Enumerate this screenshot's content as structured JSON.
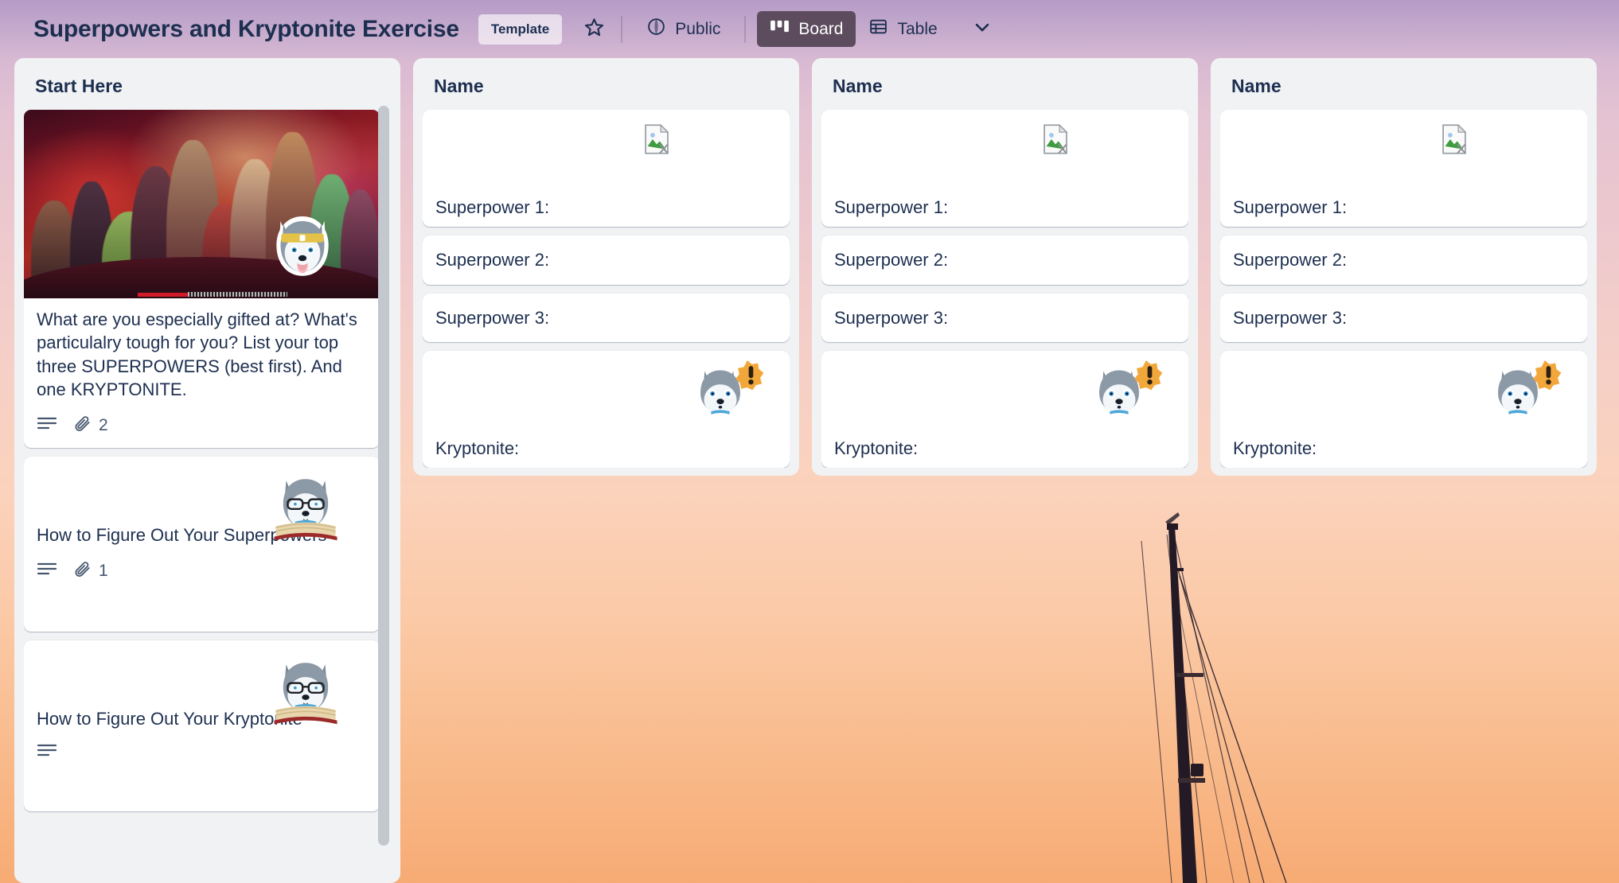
{
  "header": {
    "board_title": "Superpowers and Kryptonite Exercise",
    "template_badge": "Template",
    "star_icon": "star-outline-icon",
    "visibility_icon": "globe-icon",
    "visibility_label": "Public",
    "board_view_icon": "board-view-icon",
    "board_view_label": "Board",
    "table_view_icon": "table-view-icon",
    "table_view_label": "Table",
    "more_views_icon": "chevron-down-icon",
    "accent_active_bg": "#5d4b5e",
    "text_color": "#1d2f50"
  },
  "lists": [
    {
      "title": "Start Here",
      "cards": [
        {
          "id": "intro",
          "type": "cover",
          "cover_icon": "avengers-poster-image",
          "sticker": "husky-headband-tongue-sticker",
          "title": "What are you especially gifted at? What's particulalry tough for you? List your top three SUPERPOWERS (best first). And one KRYPTONITE.",
          "badges": {
            "description_icon": "description-lines-icon",
            "attachment_icon": "paperclip-icon",
            "attachment_count": "2"
          }
        },
        {
          "id": "how-superpowers",
          "type": "sticker",
          "sticker": "husky-glasses-book-sticker",
          "title": "How to Figure Out Your Superpowers",
          "badges": {
            "description_icon": "description-lines-icon",
            "attachment_icon": "paperclip-icon",
            "attachment_count": "1"
          }
        },
        {
          "id": "how-kryptonite",
          "type": "sticker",
          "sticker": "husky-glasses-book-sticker",
          "title": "How to Figure Out Your Kryptonite",
          "badges": {
            "description_icon": "description-lines-icon",
            "attachment_icon": "",
            "attachment_count": ""
          }
        }
      ]
    },
    {
      "title": "Name",
      "cards": [
        {
          "id": "sp1",
          "type": "tall",
          "icon": "broken-image-icon",
          "title": "Superpower 1:"
        },
        {
          "id": "sp2",
          "type": "short",
          "title": "Superpower 2:"
        },
        {
          "id": "sp3",
          "type": "short",
          "title": "Superpower 3:"
        },
        {
          "id": "kr",
          "type": "tall",
          "sticker": "husky-warning-sticker",
          "title": "Kryptonite:"
        }
      ]
    },
    {
      "title": "Name",
      "cards": [
        {
          "id": "sp1",
          "type": "tall",
          "icon": "broken-image-icon",
          "title": "Superpower 1:"
        },
        {
          "id": "sp2",
          "type": "short",
          "title": "Superpower 2:"
        },
        {
          "id": "sp3",
          "type": "short",
          "title": "Superpower 3:"
        },
        {
          "id": "kr",
          "type": "tall",
          "sticker": "husky-warning-sticker",
          "title": "Kryptonite:"
        }
      ]
    },
    {
      "title": "Name",
      "cards": [
        {
          "id": "sp1",
          "type": "tall",
          "icon": "broken-image-icon",
          "title": "Superpower 1:"
        },
        {
          "id": "sp2",
          "type": "short",
          "title": "Superpower 2:"
        },
        {
          "id": "sp3",
          "type": "short",
          "title": "Superpower 3:"
        },
        {
          "id": "kr",
          "type": "tall",
          "sticker": "husky-warning-sticker",
          "title": "Kryptonite:"
        }
      ]
    }
  ],
  "background": {
    "description": "sunset-sailboat-mast-photo",
    "top_color": "#b9a1c8",
    "bottom_color": "#f7ab74"
  }
}
